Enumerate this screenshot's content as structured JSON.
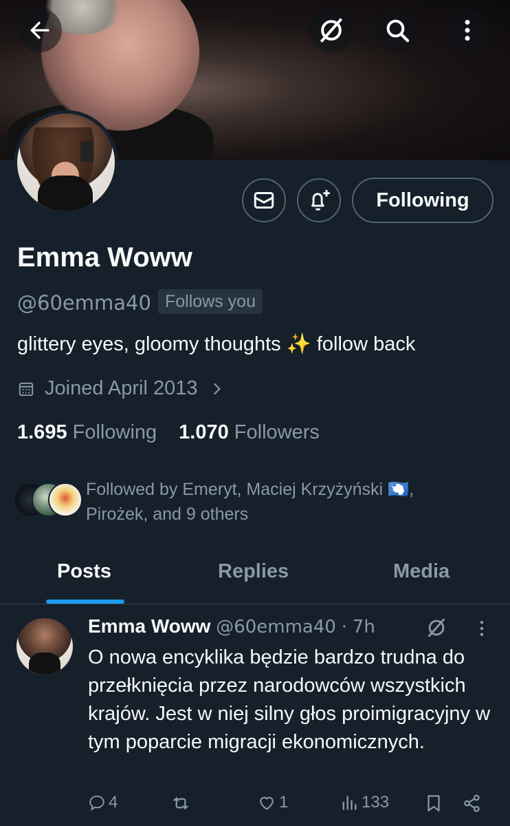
{
  "profile": {
    "name": "Emma Woww",
    "handle": "@60emma40",
    "follows_you": "Follows you",
    "bio": "glittery eyes, gloomy thoughts ✨ follow back",
    "joined": "Joined April 2013",
    "following_count": "1.695",
    "following_label": "Following",
    "followers_count": "1.070",
    "followers_label": "Followers",
    "followed_by_line1": "Followed by Emeryt, Maciej Krzyżyński 🇦🇶,",
    "followed_by_line2": "Pirożek, and 9 others"
  },
  "header": {
    "back_icon": "back-arrow-icon",
    "grok_icon": "grok-icon",
    "search_icon": "search-icon",
    "more_icon": "more-vertical-icon"
  },
  "actions": {
    "message_icon": "envelope-icon",
    "notify_icon": "bell-plus-icon",
    "following_label": "Following"
  },
  "tabs": [
    {
      "label": "Posts",
      "active": true
    },
    {
      "label": "Replies",
      "active": false
    },
    {
      "label": "Media",
      "active": false
    }
  ],
  "post": {
    "author_name": "Emma Woww",
    "author_handle": "@60emma40",
    "separator": "·",
    "time": "7h",
    "text": "O nowa encyklika będzie bardzo trudna do przełknięcia przez narodowców wszystkich krajów. Jest w niej silny głos proimigracyjny w tym poparcie migracji ekonomicznych.",
    "replies": "4",
    "reposts": "",
    "likes": "1",
    "views": "133"
  },
  "colors": {
    "background": "#15202b",
    "text_primary": "#f7f9f9",
    "text_secondary": "#8b98a5",
    "accent": "#1d9bf0",
    "border": "#536471"
  }
}
